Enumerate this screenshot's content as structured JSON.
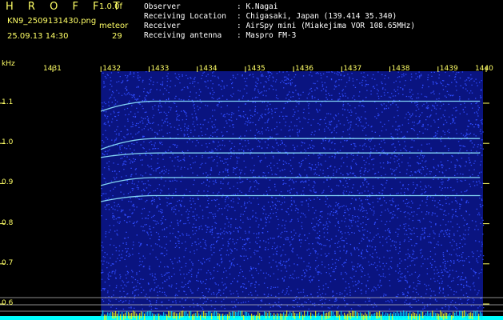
{
  "header": {
    "title": "H R O F F T",
    "version": "1.0.0f",
    "filename": "KN9_2509131430.png",
    "datetime": "25.09.13 14:30",
    "meteor_label": "meteor",
    "meteor_count": "29",
    "observer_label": "Observer",
    "observer_value": ": K.Nagai",
    "location_label": "Receiving Location",
    "location_value": ": Chigasaki, Japan (139.414 35.340)",
    "receiver_label": "Receiver",
    "receiver_value": ": AirSpy mini (Miakejima VOR 108.65MHz)",
    "antenna_label": "Receiving antenna",
    "antenna_value": ": Maspro FM-3"
  },
  "chart_data": {
    "type": "heatmap",
    "xlabel": "",
    "ylabel": "kHz",
    "x_ticks": [
      "1431",
      "1432",
      "1433",
      "1434",
      "1435",
      "1436",
      "1437",
      "1438",
      "1439",
      "1440"
    ],
    "y_ticks": [
      "1.1",
      "1.0",
      "0.9",
      "0.8",
      "0.7",
      "0.6"
    ],
    "x_range": [
      1431,
      1440
    ],
    "y_range": [
      0.6,
      1.1
    ],
    "data_start_x": 1432,
    "lines": [
      {
        "freq": 1.105,
        "start": 1.08
      },
      {
        "freq": 1.012,
        "start": 0.985
      },
      {
        "freq": 0.976,
        "start": 0.965
      },
      {
        "freq": 0.915,
        "start": 0.895
      },
      {
        "freq": 0.87,
        "start": 0.855
      }
    ],
    "colors": {
      "background": "#000000",
      "noise": "#1a2fd6",
      "trace": "#8fe8ff",
      "axis_text": "#ffff66",
      "header_text": "#ffffff"
    }
  }
}
